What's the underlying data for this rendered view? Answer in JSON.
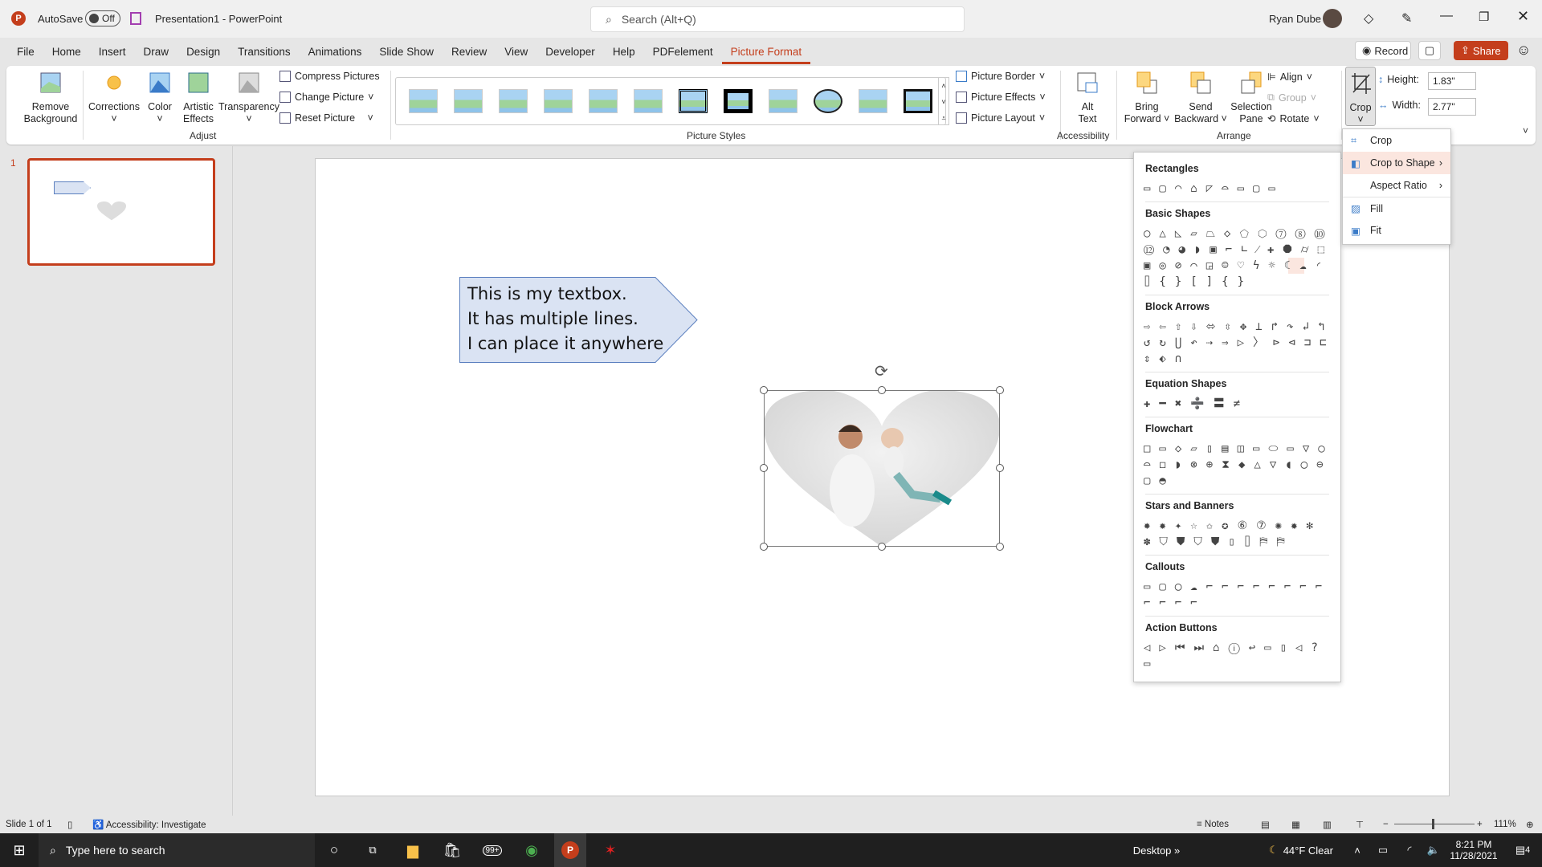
{
  "titlebar": {
    "autosave_label": "AutoSave",
    "autosave_state": "Off",
    "doc_title": "Presentation1  -  PowerPoint",
    "search_placeholder": "Search (Alt+Q)",
    "user_name": "Ryan Dube"
  },
  "menu": {
    "tabs": [
      "File",
      "Home",
      "Insert",
      "Draw",
      "Design",
      "Transitions",
      "Animations",
      "Slide Show",
      "Review",
      "View",
      "Developer",
      "Help",
      "PDFelement",
      "Picture Format"
    ],
    "active": "Picture Format",
    "record": "Record",
    "share": "Share"
  },
  "ribbon": {
    "adjust": {
      "remove_bg": [
        "Remove",
        "Background"
      ],
      "corrections": "Corrections",
      "color": "Color",
      "artistic": [
        "Artistic",
        "Effects"
      ],
      "transparency": "Transparency",
      "compress": "Compress Pictures",
      "change": "Change Picture",
      "reset": "Reset Picture",
      "group": "Adjust"
    },
    "styles": {
      "group": "Picture Styles",
      "border": "Picture Border",
      "effects": "Picture Effects",
      "layout": "Picture Layout"
    },
    "accessibility": {
      "alt": [
        "Alt",
        "Text"
      ],
      "group": "Accessibility"
    },
    "arrange": {
      "bring": [
        "Bring",
        "Forward"
      ],
      "send": [
        "Send",
        "Backward"
      ],
      "selection": [
        "Selection",
        "Pane"
      ],
      "align": "Align",
      "group_btn": "Group",
      "rotate": "Rotate",
      "group": "Arrange"
    },
    "size": {
      "crop": "Crop",
      "height_label": "Height:",
      "height": "1.83\"",
      "width_label": "Width:",
      "width": "2.77\""
    }
  },
  "thumbnail": {
    "number": "1"
  },
  "slide": {
    "textbox_lines": [
      "This is my textbox.",
      "It has multiple lines.",
      "I can place it anywhere"
    ]
  },
  "crop_menu": {
    "items": [
      {
        "label": "Crop",
        "icon": "crop-icon"
      },
      {
        "label": "Crop to Shape",
        "icon": "crop-to-shape-icon",
        "submenu": true
      },
      {
        "label": "Aspect Ratio",
        "submenu": true
      },
      {
        "label": "Fill",
        "icon": "fill-icon"
      },
      {
        "label": "Fit",
        "icon": "fit-icon"
      }
    ]
  },
  "shapes": [
    {
      "title": "Rectangles",
      "glyphs": "▭▢◠⌂◸⌓▭▢▭"
    },
    {
      "title": "Basic Shapes",
      "glyphs": "○△◺▱⏢◇⬠⬡⑦⑧⑩⑫◔◕◗▣⌐∟⁄✚⯃⌭⬚▣◎⊘⌒◲☺♡ϟ☼☾☁◜⌷{}[]{}"
    },
    {
      "title": "Block Arrows",
      "glyphs": "⇨⇦⇧⇩⬄⇳✥⊥↱↷↲↰↺↻⋃↶⇢⇒▷〉⊳⊲⊐⊏⇕⬖∩"
    },
    {
      "title": "Equation Shapes",
      "glyphs": "✚━✖➗〓≠"
    },
    {
      "title": "Flowchart",
      "glyphs": "□▭◇▱▯▤◫▭⬭▭▽○⌓◻◗⊗⊕⧗◆△▽◖◯⊖▢◓"
    },
    {
      "title": "Stars and Banners",
      "glyphs": "✸✹✦☆✩✪⑥⑦✺✹✻✽⛉⛊⛉⛊▯⌷⛿⛿"
    },
    {
      "title": "Callouts",
      "glyphs": "▭▢◯☁⌐⌐⌐⌐⌐⌐⌐⌐⌐⌐⌐⌐"
    },
    {
      "title": "Action Buttons",
      "glyphs": "◁▷⏮⏭⌂ⓘ↩▭▯◁?▭"
    }
  ],
  "status": {
    "slide": "Slide 1 of 1",
    "accessibility": "Accessibility: Investigate",
    "notes": "Notes",
    "zoom": "111%",
    "zoom_level_percent": 111
  },
  "taskbar": {
    "search_placeholder": "Type here to search",
    "mail_badge": "99+",
    "desktop": "Desktop",
    "weather": "44°F  Clear",
    "time": "8:21 PM",
    "date": "11/28/2021",
    "notification_count": "4"
  },
  "colors": {
    "accent": "#c43e1c",
    "taskbar": "#1f1f1f",
    "shape_fill": "#dae3f3"
  }
}
